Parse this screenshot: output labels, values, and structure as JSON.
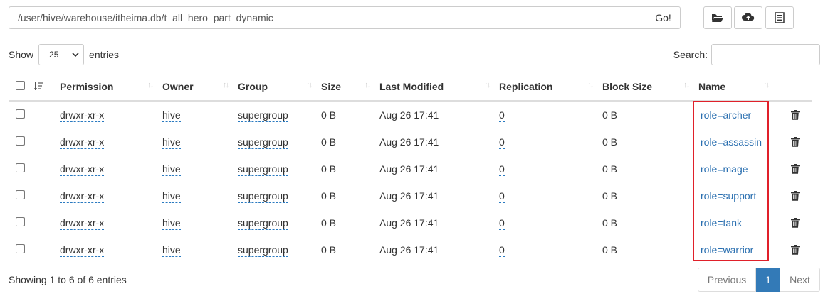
{
  "pathbar": {
    "path": "/user/hive/warehouse/itheima.db/t_all_hero_part_dynamic",
    "go_label": "Go!"
  },
  "toolbar": {
    "icons": [
      "folder-open-icon",
      "upload-icon",
      "list-icon"
    ]
  },
  "length": {
    "show_label": "Show",
    "selected": "25",
    "entries_label": "entries"
  },
  "search": {
    "label": "Search:"
  },
  "table": {
    "headers": [
      "Permission",
      "Owner",
      "Group",
      "Size",
      "Last Modified",
      "Replication",
      "Block Size",
      "Name"
    ],
    "rows": [
      {
        "permission": "drwxr-xr-x",
        "owner": "hive",
        "group": "supergroup",
        "size": "0 B",
        "modified": "Aug 26 17:41",
        "replication": "0",
        "block_size": "0 B",
        "name": "role=archer"
      },
      {
        "permission": "drwxr-xr-x",
        "owner": "hive",
        "group": "supergroup",
        "size": "0 B",
        "modified": "Aug 26 17:41",
        "replication": "0",
        "block_size": "0 B",
        "name": "role=assassin"
      },
      {
        "permission": "drwxr-xr-x",
        "owner": "hive",
        "group": "supergroup",
        "size": "0 B",
        "modified": "Aug 26 17:41",
        "replication": "0",
        "block_size": "0 B",
        "name": "role=mage"
      },
      {
        "permission": "drwxr-xr-x",
        "owner": "hive",
        "group": "supergroup",
        "size": "0 B",
        "modified": "Aug 26 17:41",
        "replication": "0",
        "block_size": "0 B",
        "name": "role=support"
      },
      {
        "permission": "drwxr-xr-x",
        "owner": "hive",
        "group": "supergroup",
        "size": "0 B",
        "modified": "Aug 26 17:41",
        "replication": "0",
        "block_size": "0 B",
        "name": "role=tank"
      },
      {
        "permission": "drwxr-xr-x",
        "owner": "hive",
        "group": "supergroup",
        "size": "0 B",
        "modified": "Aug 26 17:41",
        "replication": "0",
        "block_size": "0 B",
        "name": "role=warrior"
      }
    ]
  },
  "footer": {
    "info": "Showing 1 to 6 of 6 entries"
  },
  "pagination": {
    "previous": "Previous",
    "current": "1",
    "next": "Next"
  },
  "colors": {
    "link": "#2a6fb0",
    "highlight_box": "#e0202a",
    "page_active": "#337ab7"
  }
}
